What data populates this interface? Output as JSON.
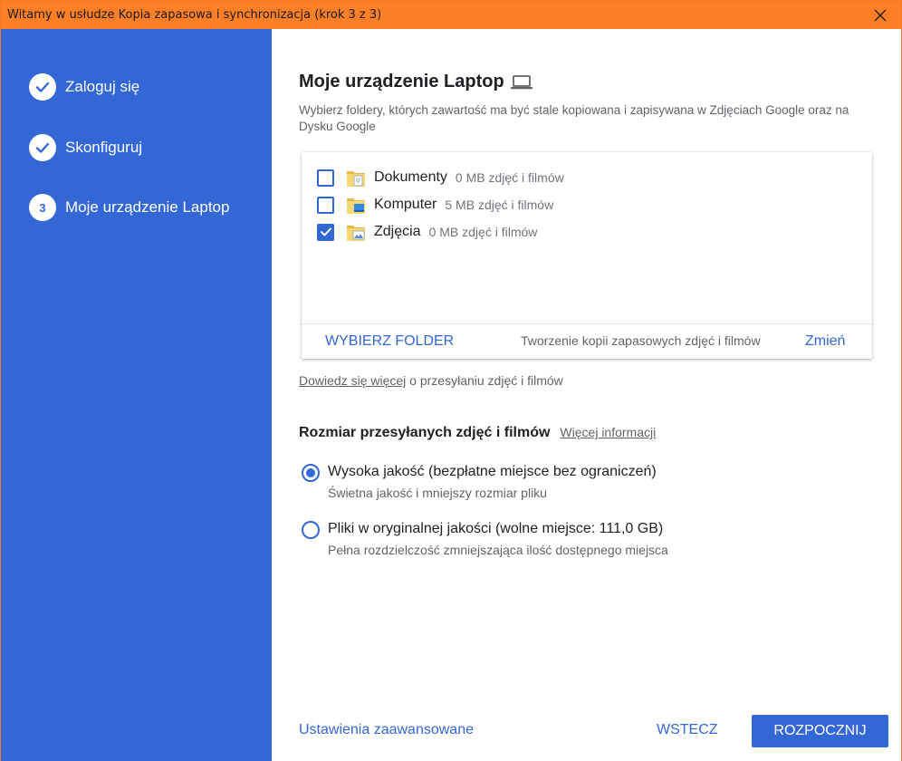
{
  "window": {
    "title": "Witamy w usłudze Kopia zapasowa i synchronizacja (krok 3 z 3)"
  },
  "sidebar": {
    "steps": [
      {
        "label": "Zaloguj się",
        "state": "done"
      },
      {
        "label": "Skonfiguruj",
        "state": "done"
      },
      {
        "number": "3",
        "label": "Moje urządzenie Laptop",
        "state": "current"
      }
    ]
  },
  "main": {
    "heading": "Moje urządzenie Laptop",
    "description": "Wybierz foldery, których zawartość ma być stale kopiowana i zapisywana w Zdjęciach Google oraz na Dysku Google",
    "folders": [
      {
        "name": "Dokumenty",
        "size": "0 MB zdjęć i filmów",
        "checked": false
      },
      {
        "name": "Komputer",
        "size": "5 MB zdjęć i filmów",
        "checked": false
      },
      {
        "name": "Zdjęcia",
        "size": "0 MB zdjęć i filmów",
        "checked": true
      }
    ],
    "choose_folder": "WYBIERZ FOLDER",
    "backup_label": "Tworzenie kopii zapasowych zdjęć i filmów",
    "change": "Zmień",
    "learn_link": "Dowiedz się więcej",
    "learn_rest": " o przesyłaniu zdjęć i filmów",
    "size_title": "Rozmiar przesyłanych zdjęć i filmów",
    "more_info": "Więcej informacji",
    "options": [
      {
        "label": "Wysoka jakość (bezpłatne miejsce bez ograniczeń)",
        "sub": "Świetna jakość i mniejszy rozmiar pliku",
        "selected": true
      },
      {
        "label": "Pliki w oryginalnej jakości (wolne miejsce: 111,0 GB)",
        "sub": "Pełna rozdzielczość zmniejszająca ilość dostępnego miejsca",
        "selected": false
      }
    ]
  },
  "footer": {
    "advanced": "Ustawienia zaawansowane",
    "back": "WSTECZ",
    "start": "ROZPOCZNIJ"
  },
  "colors": {
    "accent": "#3367d6",
    "titlebar": "#ff7f27",
    "secondary_text": "#5f6368"
  }
}
